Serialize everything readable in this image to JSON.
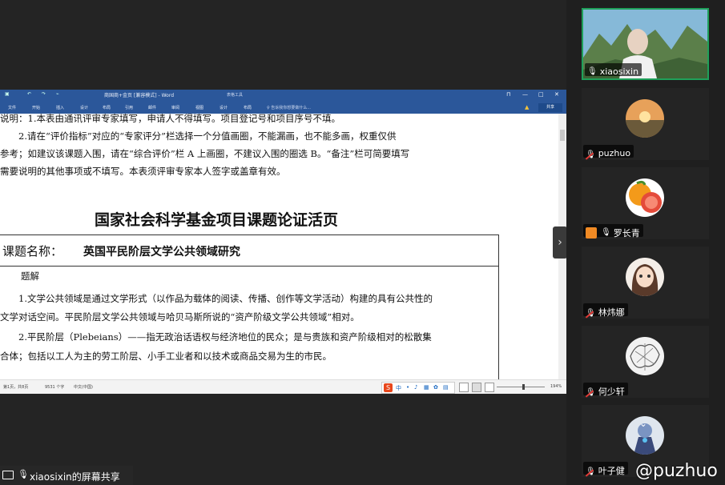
{
  "word": {
    "doc_title": "商国商+金页 [兼容模式] - Word",
    "context_tool": "表格工具",
    "window_buttons": [
      "⊓",
      "—",
      "□",
      "✕"
    ],
    "quick_access": [
      "↶",
      "↷",
      "⌁"
    ],
    "ribbon_tabs": [
      "文件",
      "开始",
      "插入",
      "设计",
      "布局",
      "引用",
      "邮件",
      "审阅",
      "视图",
      "设计",
      "布局"
    ],
    "tell_me": "♀ 告诉我你想要做什么...",
    "share_label": "共享",
    "status": {
      "page": "第1页，共8页",
      "words": "9531 个字",
      "lang": "中文(中国)",
      "zoom": "194%"
    }
  },
  "document": {
    "notes": [
      "说明：1.本表由通讯评审专家填写，申请人不得填写。项目登记号和项目序号不填。",
      "　　2.请在“评价指标”对应的“专家评分”栏选择一个分值画圈，不能漏画，也不能多画，权重仅供",
      "参考；如建议该课题入围，请在“综合评价”栏 A 上画圈，不建议入围的圈选 B。“备注”栏可简要填写",
      "需要说明的其他事项或不填写。本表须评审专家本人签字或盖章有效。"
    ],
    "title": "国家社会科学基金项目课题论证活页",
    "topic_label": "课题名称：",
    "topic_value": "英国平民阶层文学公共领域研究",
    "section_heading": "题解",
    "body": [
      "　　1.文学公共领域是通过文学形式（以作品为载体的阅读、传播、创作等文学活动）构建的具有公共性的",
      "文学对话空间。平民阶层文学公共领域与哈贝马斯所说的“资产阶级文学公共领域”相对。",
      "　　2.平民阶层（Plebeians）——指无政治话语权与经济地位的民众；是与贵族和资产阶级相对的松散集",
      "合体；包括以工人为主的劳工阶层、小手工业者和以技术或商品交易为生的市民。"
    ]
  },
  "screen_share": {
    "label": "xiaosixin的屏幕共享"
  },
  "participants": [
    {
      "name": "xiaosixin",
      "mic": "on"
    },
    {
      "name": "puzhuo",
      "mic": "muted"
    },
    {
      "name": "罗长青",
      "mic": "on"
    },
    {
      "name": "林炜娜",
      "mic": "muted"
    },
    {
      "name": "何少轩",
      "mic": "muted"
    },
    {
      "name": "叶子健",
      "mic": "muted"
    }
  ],
  "watermark": "@puzhuo",
  "colors": {
    "word_blue": "#2b579a",
    "sidebar": "#1f1f1f",
    "active_border": "#1fa05a",
    "mute_red": "#e53935"
  }
}
